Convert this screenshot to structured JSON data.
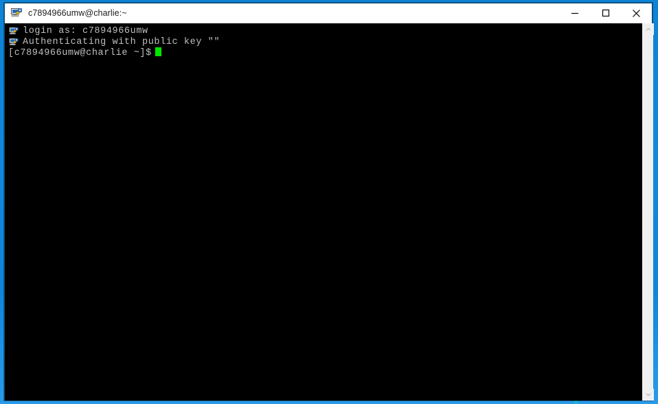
{
  "desktop": {
    "background_color": "#1288dd",
    "accent_mark_color": "#19c8d6"
  },
  "window": {
    "titlebar": {
      "icon": "putty-terminal-icon",
      "title": "c7894966umw@charlie:~",
      "background_color": "#ffffff",
      "text_color": "#1a1a1a",
      "controls": [
        {
          "name": "minimize-button",
          "icon": "minimize-icon",
          "label": "—"
        },
        {
          "name": "maximize-button",
          "icon": "maximize-icon",
          "label": "□"
        },
        {
          "name": "close-button",
          "icon": "close-icon",
          "label": "✕"
        }
      ]
    },
    "terminal": {
      "background_color": "#000000",
      "foreground_color": "#bfbfbf",
      "cursor_color": "#00e600",
      "cursor_style": "block",
      "lines": [
        {
          "text": "login as: c7894966umw",
          "indented": true,
          "artifact_icon": "putty-terminal-icon"
        },
        {
          "text": "Authenticating with public key \"\"",
          "indented": true,
          "artifact_icon": "putty-terminal-icon"
        },
        {
          "text": "[c7894966umw@charlie ~]$",
          "indented": false,
          "artifact_icon": null
        }
      ],
      "prompt": "[c7894966umw@charlie ~]$",
      "user": "c7894966umw",
      "host": "charlie",
      "cwd": "~"
    },
    "scrollbar": {
      "track_color": "#f0f0f0",
      "up_arrow": "chevron-up-icon",
      "down_arrow": "chevron-down-icon",
      "thumb_visible": false
    }
  }
}
